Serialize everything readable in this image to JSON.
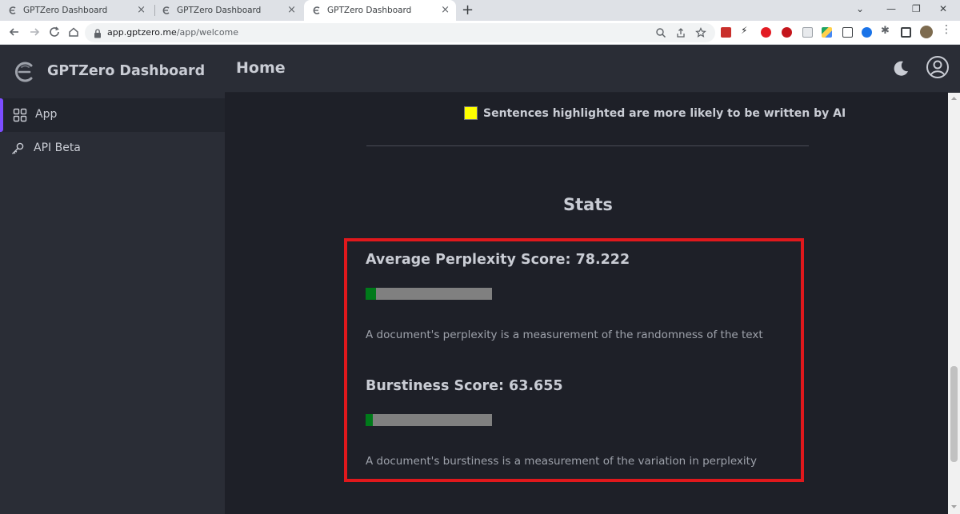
{
  "browser": {
    "tabs": [
      {
        "title": "GPTZero Dashboard",
        "active": false
      },
      {
        "title": "GPTZero Dashboard",
        "active": false
      },
      {
        "title": "GPTZero Dashboard",
        "active": true
      }
    ],
    "close_glyph": "×",
    "new_tab_glyph": "+",
    "url_host": "app.gptzero.me",
    "url_path": "/app/welcome"
  },
  "sidebar": {
    "brand_title": "GPTZero Dashboard",
    "items": [
      {
        "label": "App",
        "icon": "grid-icon",
        "active": true
      },
      {
        "label": "API Beta",
        "icon": "key-icon",
        "active": false
      }
    ]
  },
  "header": {
    "title": "Home"
  },
  "main": {
    "legend_text": "Sentences highlighted are more likely to be written by AI",
    "legend_color": "#ffff00",
    "stats_title": "Stats",
    "perplexity": {
      "title": "Average Perplexity Score: 78.222",
      "meter_fill_percent": 8,
      "description": "A document's perplexity is a measurement of the randomness of the text"
    },
    "burstiness": {
      "title": "Burstiness Score: 63.655",
      "meter_fill_percent": 6,
      "description": "A document's burstiness is a measurement of the variation in perplexity"
    }
  },
  "colors": {
    "accent": "#7c4dff",
    "highlight_border": "#e0181c",
    "meter_fill": "#007a1a",
    "meter_track": "#808080"
  }
}
